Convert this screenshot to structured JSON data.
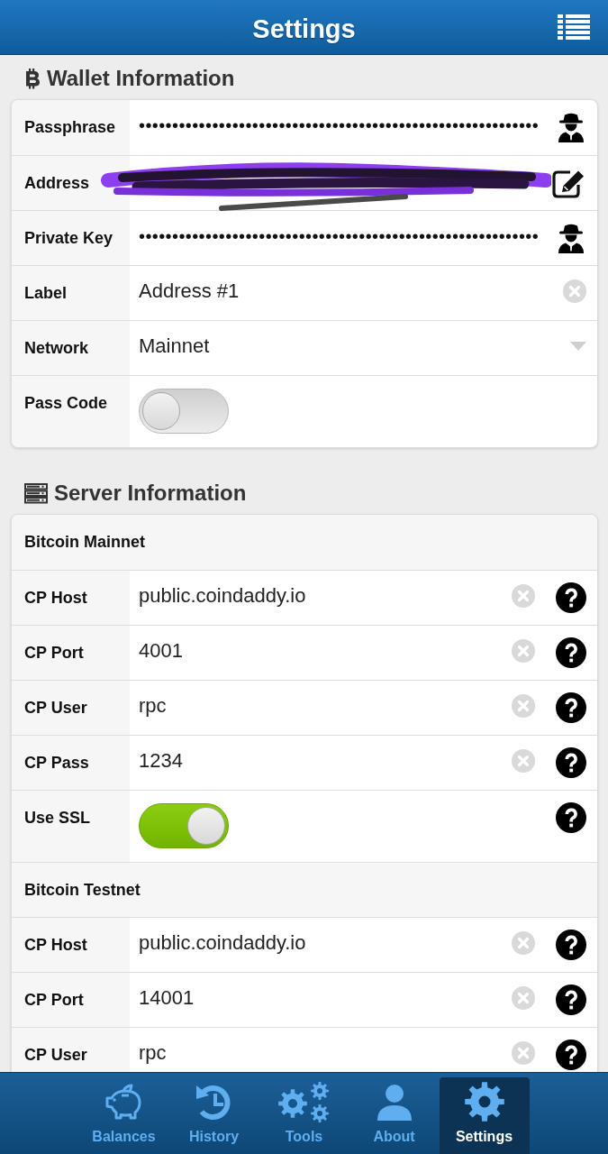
{
  "header": {
    "title": "Settings"
  },
  "wallet": {
    "title": "Wallet Information",
    "rows": [
      {
        "label": "Passphrase",
        "kind": "secret",
        "value": "••••••••••••••••••••••••••••••••••••••••••••••••••••••••••••"
      },
      {
        "label": "Address",
        "kind": "redacted"
      },
      {
        "label": "Private Key",
        "kind": "secret",
        "value": "••••••••••••••••••••••••••••••••••••••••••••••••••••••••••••"
      },
      {
        "label": "Label",
        "kind": "text",
        "value": "Address #1"
      },
      {
        "label": "Network",
        "kind": "select",
        "value": "Mainnet"
      },
      {
        "label": "Pass Code",
        "kind": "toggle",
        "on": false
      }
    ]
  },
  "servers": {
    "title": "Server Information",
    "groups": [
      {
        "title": "Bitcoin Mainnet",
        "rows": [
          {
            "label": "CP Host",
            "kind": "text",
            "value": "public.coindaddy.io"
          },
          {
            "label": "CP Port",
            "kind": "text",
            "value": "4001"
          },
          {
            "label": "CP User",
            "kind": "text",
            "value": "rpc"
          },
          {
            "label": "CP Pass",
            "kind": "text",
            "value": "1234"
          },
          {
            "label": "Use SSL",
            "kind": "toggle",
            "on": true
          }
        ]
      },
      {
        "title": "Bitcoin Testnet",
        "rows": [
          {
            "label": "CP Host",
            "kind": "text",
            "value": "public.coindaddy.io"
          },
          {
            "label": "CP Port",
            "kind": "text",
            "value": "14001"
          },
          {
            "label": "CP User",
            "kind": "text",
            "value": "rpc"
          }
        ]
      }
    ]
  },
  "nav": {
    "items": [
      {
        "label": "Balances",
        "selected": false
      },
      {
        "label": "History",
        "selected": false
      },
      {
        "label": "Tools",
        "selected": false
      },
      {
        "label": "About",
        "selected": false
      },
      {
        "label": "Settings",
        "selected": true
      }
    ]
  }
}
